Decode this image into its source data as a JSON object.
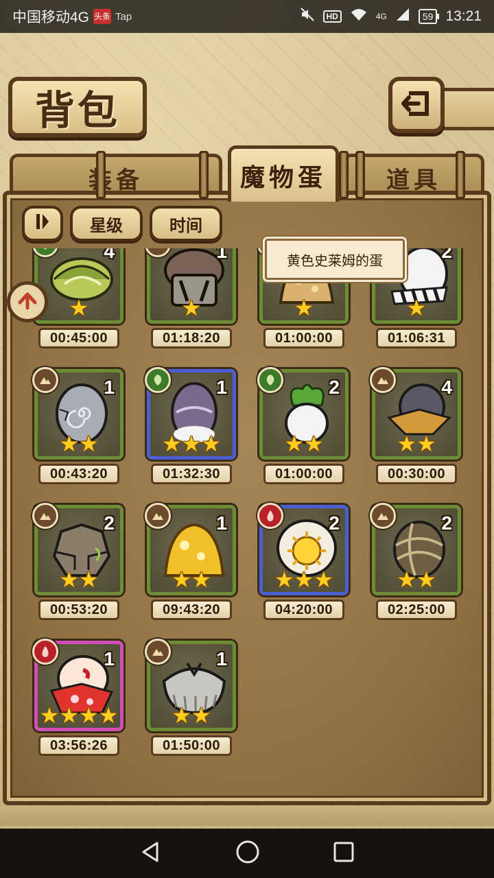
{
  "status_bar": {
    "carrier": "中国移动4G",
    "badge_news": "头条",
    "badge_tap": "Tap",
    "hd": "HD",
    "network": "4G",
    "battery": "59",
    "time": "13:21"
  },
  "header": {
    "title": "背包"
  },
  "tabs": [
    {
      "label": "装备",
      "active": false
    },
    {
      "label": "魔物蛋",
      "active": true
    },
    {
      "label": "道具",
      "active": false
    }
  ],
  "filters": {
    "star_label": "星级",
    "time_label": "时间"
  },
  "tooltip": {
    "text": "黄色史莱姆的蛋"
  },
  "eggs": [
    {
      "count": "4",
      "stars": "★",
      "timer": "00:45:00",
      "element": "grass",
      "frame": "green",
      "icon": "leaf-egg-icon"
    },
    {
      "count": "1",
      "stars": "★",
      "timer": "01:18:20",
      "element": "earth",
      "frame": "green",
      "icon": "mushroom-egg-icon"
    },
    {
      "count": "",
      "stars": "★",
      "timer": "01:00:00",
      "element": "earth",
      "frame": "green",
      "icon": "slime-egg-icon"
    },
    {
      "count": "2",
      "stars": "★",
      "timer": "01:06:31",
      "element": "earth",
      "frame": "green",
      "icon": "striped-egg-icon"
    },
    {
      "count": "1",
      "stars": "★★",
      "timer": "00:43:20",
      "element": "earth",
      "frame": "green",
      "icon": "stone-spiral-egg-icon"
    },
    {
      "count": "1",
      "stars": "★★★",
      "timer": "01:32:30",
      "element": "grass",
      "frame": "blue",
      "icon": "purple-egg-icon"
    },
    {
      "count": "2",
      "stars": "★★",
      "timer": "01:00:00",
      "element": "grass",
      "frame": "green",
      "icon": "radish-egg-icon"
    },
    {
      "count": "4",
      "stars": "★★",
      "timer": "00:30:00",
      "element": "earth",
      "frame": "green",
      "icon": "cloak-egg-icon"
    },
    {
      "count": "2",
      "stars": "★★",
      "timer": "00:53:20",
      "element": "earth",
      "frame": "green",
      "icon": "rock-egg-icon"
    },
    {
      "count": "1",
      "stars": "★★",
      "timer": "09:43:20",
      "element": "earth",
      "frame": "green",
      "icon": "gold-slime-egg-icon"
    },
    {
      "count": "2",
      "stars": "★★★",
      "timer": "04:20:00",
      "element": "fire",
      "frame": "blue",
      "icon": "sun-egg-icon"
    },
    {
      "count": "2",
      "stars": "★★",
      "timer": "02:25:00",
      "element": "earth",
      "frame": "green",
      "icon": "wrapped-egg-icon"
    },
    {
      "count": "1",
      "stars": "★★★★",
      "timer": "03:56:26",
      "element": "fire",
      "frame": "pink",
      "icon": "kimono-egg-icon"
    },
    {
      "count": "1",
      "stars": "★★",
      "timer": "01:50:00",
      "element": "earth",
      "frame": "green",
      "icon": "grey-fur-egg-icon"
    }
  ],
  "colors": {
    "frame_green": "#6d8c34",
    "frame_blue": "#4a5fd4",
    "frame_pink": "#cf4fb6",
    "wood_dark": "#5a3a1d",
    "parchment": "#f4e2b3",
    "star": "#ffcc22"
  }
}
